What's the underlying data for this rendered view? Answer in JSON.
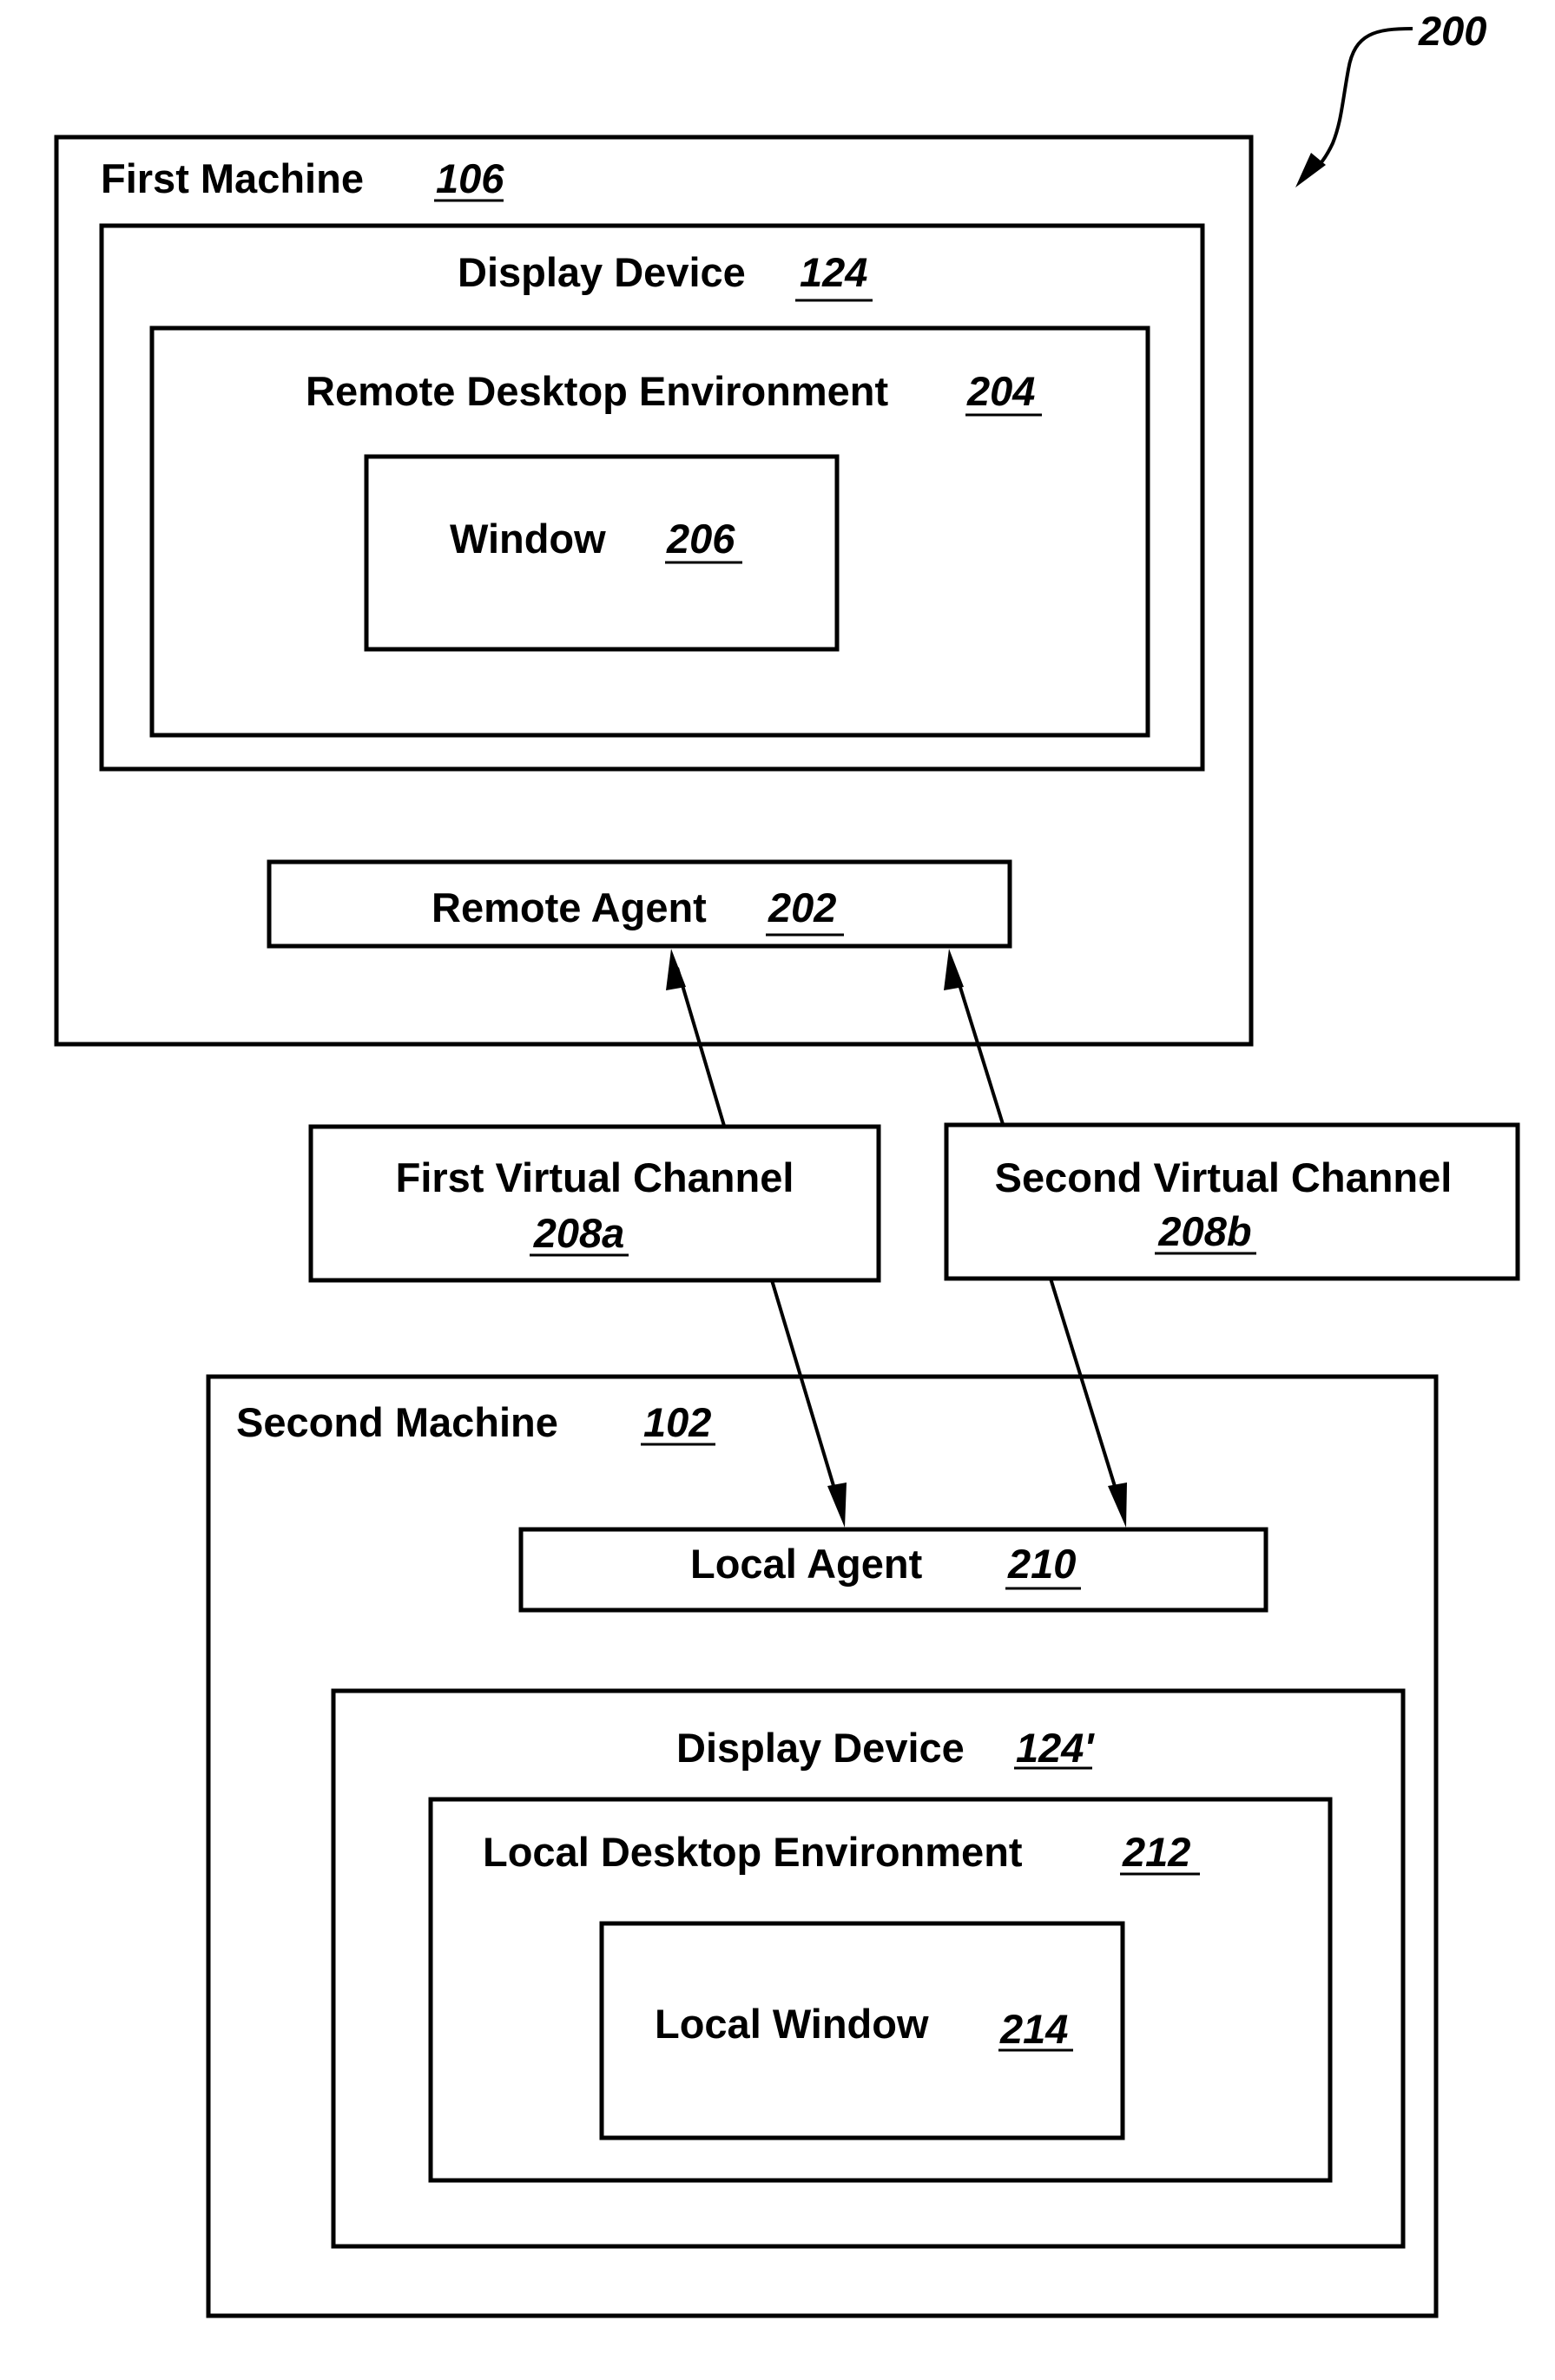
{
  "figure": {
    "reference": "200",
    "colors": {
      "line": "#000000",
      "background": "#ffffff"
    }
  },
  "first_machine": {
    "label": "First Machine",
    "ref": "106",
    "display_device": {
      "label": "Display Device",
      "ref": "124",
      "remote_desktop_environment": {
        "label": "Remote Desktop Environment",
        "ref": "204",
        "window": {
          "label": "Window",
          "ref": "206"
        }
      }
    },
    "remote_agent": {
      "label": "Remote Agent",
      "ref": "202"
    }
  },
  "virtual_channels": [
    {
      "label": "First Virtual Channel",
      "ref": "208a"
    },
    {
      "label": "Second Virtual Channel",
      "ref": "208b"
    }
  ],
  "second_machine": {
    "label": "Second Machine",
    "ref": "102",
    "local_agent": {
      "label": "Local Agent",
      "ref": "210"
    },
    "display_device": {
      "label": "Display Device",
      "ref": "124'",
      "local_desktop_environment": {
        "label": "Local Desktop Environment",
        "ref": "212",
        "local_window": {
          "label": "Local Window",
          "ref": "214"
        }
      }
    }
  },
  "connections": [
    {
      "from": "Remote Agent 202",
      "to": "First Virtual Channel 208a",
      "direction": "bidirectional"
    },
    {
      "from": "Remote Agent 202",
      "to": "Second Virtual Channel 208b",
      "direction": "bidirectional"
    },
    {
      "from": "First Virtual Channel 208a",
      "to": "Local Agent 210",
      "direction": "bidirectional"
    },
    {
      "from": "Second Virtual Channel 208b",
      "to": "Local Agent 210",
      "direction": "bidirectional"
    }
  ]
}
